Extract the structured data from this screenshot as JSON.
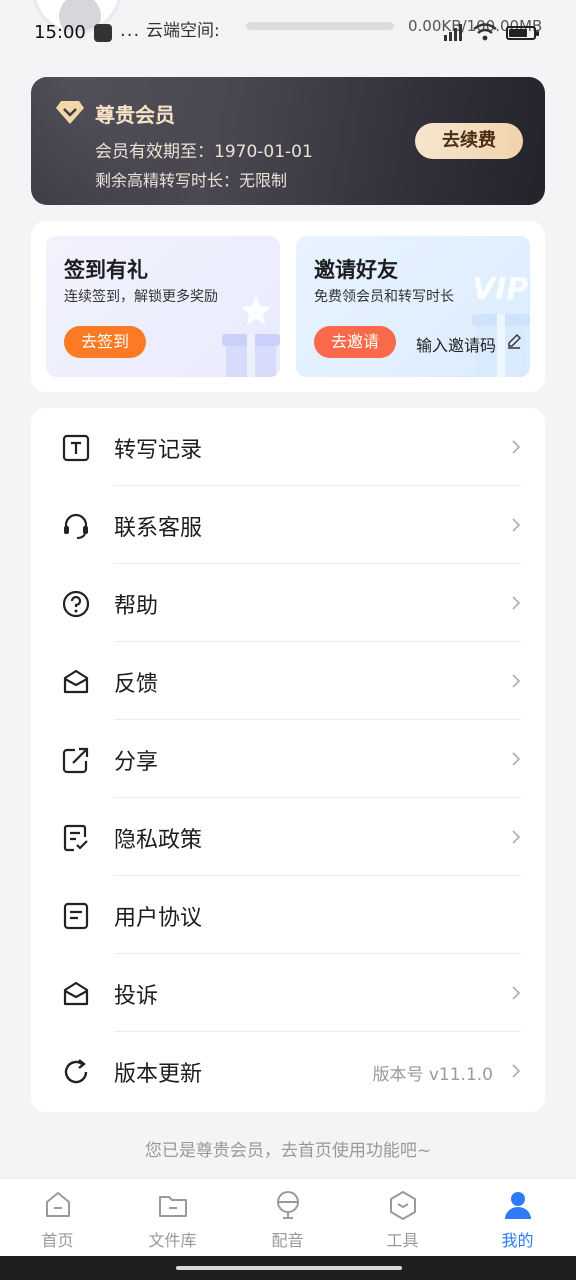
{
  "status_bar": {
    "time": "15:00",
    "dots": "...",
    "cloud_label": "云端空间:",
    "cloud_value": "0.00KB/100.00MB"
  },
  "vip_card": {
    "title": "尊贵会员",
    "expire": "会员有效期至：1970-01-01",
    "remain": "剩余高精转写时长：无限制",
    "renew_label": "去续费"
  },
  "promos": {
    "signin": {
      "title": "签到有礼",
      "subtitle": "连续签到，解锁更多奖励",
      "button": "去签到"
    },
    "invite": {
      "title": "邀请好友",
      "subtitle": "免费领会员和转写时长",
      "button": "去邀请",
      "code_label": "输入邀请码",
      "watermark": "VIP"
    }
  },
  "menu": {
    "items": [
      {
        "label": "转写记录",
        "icon": "transcript-icon"
      },
      {
        "label": "联系客服",
        "icon": "headset-icon"
      },
      {
        "label": "帮助",
        "icon": "help-icon"
      },
      {
        "label": "反馈",
        "icon": "mail-icon"
      },
      {
        "label": "分享",
        "icon": "share-icon"
      },
      {
        "label": "隐私政策",
        "icon": "privacy-icon"
      },
      {
        "label": "用户协议",
        "icon": "agreement-icon"
      },
      {
        "label": "投诉",
        "icon": "complaint-icon"
      },
      {
        "label": "版本更新",
        "icon": "refresh-icon",
        "version": "版本号 v11.1.0"
      }
    ]
  },
  "footer_note": "您已是尊贵会员，去首页使用功能吧~",
  "tabs": [
    {
      "label": "首页",
      "icon": "home-icon"
    },
    {
      "label": "文件库",
      "icon": "folder-icon"
    },
    {
      "label": "配音",
      "icon": "dubbing-icon"
    },
    {
      "label": "工具",
      "icon": "tools-icon"
    },
    {
      "label": "我的",
      "icon": "profile-icon",
      "active": true
    }
  ],
  "colors": {
    "accent": "#2b7cf6",
    "signin_button": "#fb7a23",
    "invite_button": "#fa6a4a",
    "vip_gold": "#f6e3c7"
  }
}
